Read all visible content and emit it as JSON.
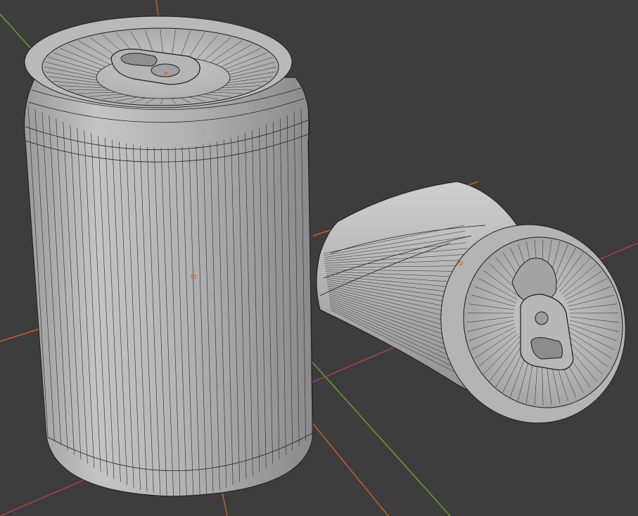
{
  "viewport": {
    "background": "#3d3d3d",
    "mesh_fill_light": "#c9c9c9",
    "mesh_fill_mid": "#a8a8a8",
    "mesh_fill_dark": "#868686",
    "wire_color": "#1c1c1c",
    "axis_x_color": "#c2444f",
    "axis_y_color": "#6e9a2e",
    "selected_edge_color": "#e5632a",
    "origin_dot_color": "#e5632a"
  },
  "objects": [
    {
      "name": "upright-can",
      "state": "standing"
    },
    {
      "name": "crushed-can",
      "state": "lying-on-side"
    }
  ]
}
